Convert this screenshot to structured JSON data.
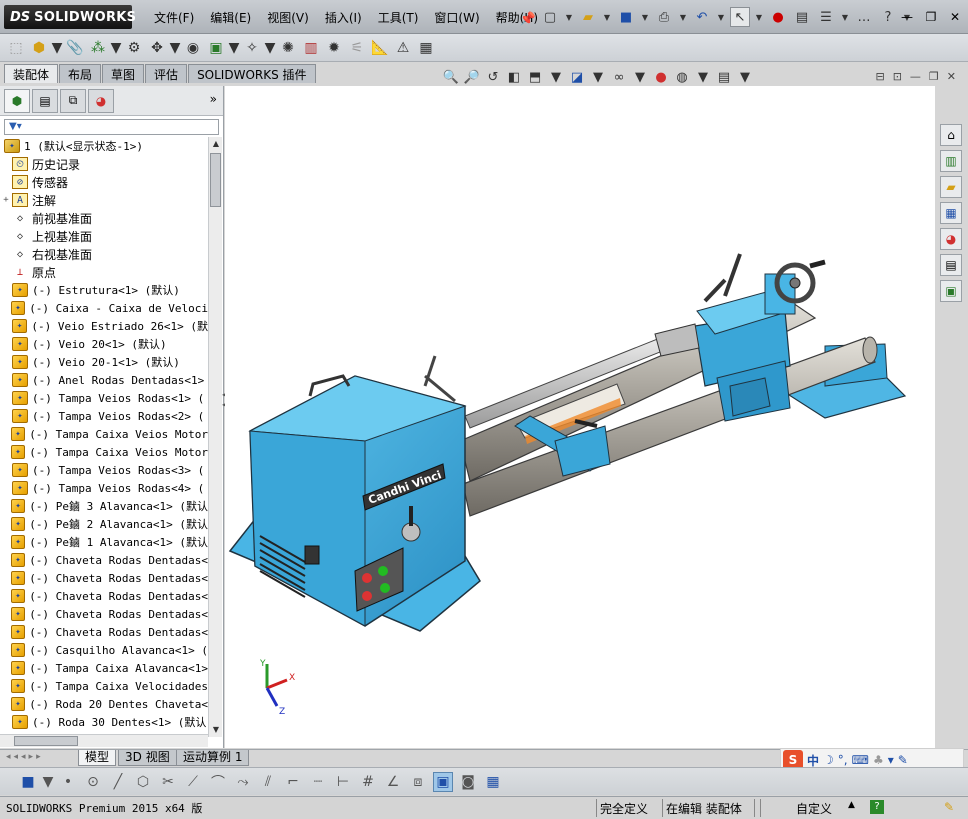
{
  "app": {
    "brand_ds": "DS",
    "brand_name": "SOLIDWORKS"
  },
  "menu": [
    "文件(F)",
    "编辑(E)",
    "视图(V)",
    "插入(I)",
    "工具(T)",
    "窗口(W)",
    "帮助(H)"
  ],
  "command_tabs": [
    "装配体",
    "布局",
    "草图",
    "评估",
    "SOLIDWORKS 插件"
  ],
  "active_command_tab": "装配体",
  "tree": {
    "root": "1  (默认<显示状态-1>)",
    "items": [
      {
        "label": "历史记录",
        "icon": "history-icon",
        "kind": "cn"
      },
      {
        "label": "传感器",
        "icon": "sensor-icon",
        "kind": "cn"
      },
      {
        "label": "注解",
        "icon": "annotation-icon",
        "kind": "cn",
        "expand": "+"
      },
      {
        "label": "前视基准面",
        "icon": "plane-icon",
        "kind": "cn"
      },
      {
        "label": "上视基准面",
        "icon": "plane-icon",
        "kind": "cn"
      },
      {
        "label": "右视基准面",
        "icon": "plane-icon",
        "kind": "cn"
      },
      {
        "label": "原点",
        "icon": "origin-icon",
        "kind": "cn"
      },
      {
        "label": "(-) Estrutura<1> (默认)",
        "icon": "part-icon"
      },
      {
        "label": "(-) Caixa - Caixa de Veloci",
        "icon": "part-icon"
      },
      {
        "label": "(-) Veio Estriado 26<1> (默",
        "icon": "part-icon"
      },
      {
        "label": "(-) Veio 20<1> (默认)",
        "icon": "part-icon"
      },
      {
        "label": "(-) Veio 20-1<1> (默认)",
        "icon": "part-icon"
      },
      {
        "label": "(-) Anel Rodas Dentadas<1>",
        "icon": "part-icon"
      },
      {
        "label": "(-) Tampa Veios Rodas<1> (",
        "icon": "part-icon"
      },
      {
        "label": "(-) Tampa Veios Rodas<2> (",
        "icon": "part-icon"
      },
      {
        "label": "(-) Tampa Caixa Veios Motor",
        "icon": "part-icon"
      },
      {
        "label": "(-) Tampa Caixa Veios Motor",
        "icon": "part-icon"
      },
      {
        "label": "(-) Tampa Veios Rodas<3> (",
        "icon": "part-icon"
      },
      {
        "label": "(-) Tampa Veios Rodas<4> (",
        "icon": "part-icon"
      },
      {
        "label": "(-) Pe鏀 3 Alavanca<1> (默认",
        "icon": "part-icon"
      },
      {
        "label": "(-) Pe鏀 2 Alavanca<1> (默认",
        "icon": "part-icon"
      },
      {
        "label": "(-) Pe鏀 1 Alavanca<1> (默认",
        "icon": "part-icon"
      },
      {
        "label": "(-) Chaveta Rodas Dentadas<",
        "icon": "part-icon"
      },
      {
        "label": "(-) Chaveta Rodas Dentadas<",
        "icon": "part-icon"
      },
      {
        "label": "(-) Chaveta Rodas Dentadas<",
        "icon": "part-icon"
      },
      {
        "label": "(-) Chaveta Rodas Dentadas<",
        "icon": "part-icon"
      },
      {
        "label": "(-) Chaveta Rodas Dentadas<",
        "icon": "part-icon"
      },
      {
        "label": "(-) Casquilho Alavanca<1> (",
        "icon": "part-icon"
      },
      {
        "label": "(-) Tampa Caixa Alavanca<1>",
        "icon": "part-icon"
      },
      {
        "label": "(-) Tampa Caixa Velocidades",
        "icon": "part-icon"
      },
      {
        "label": "(-) Roda 20 Dentes Chaveta<",
        "icon": "part-icon"
      },
      {
        "label": "(-) Roda 30 Dentes<1> (默认",
        "icon": "part-icon"
      }
    ]
  },
  "model": {
    "nameplate": "Candhi Vinci"
  },
  "triad": {
    "x": "X",
    "y": "Y",
    "z": "Z"
  },
  "bottom_tabs": [
    "模型",
    "3D 视图",
    "运动算例 1"
  ],
  "active_bottom_tab": "模型",
  "ime": {
    "logo": "S",
    "lang": "中"
  },
  "status": {
    "product": "SOLIDWORKS Premium 2015 x64 版",
    "state": "完全定义",
    "editing": "在编辑 装配体",
    "units": "自定义",
    "help": "?"
  }
}
